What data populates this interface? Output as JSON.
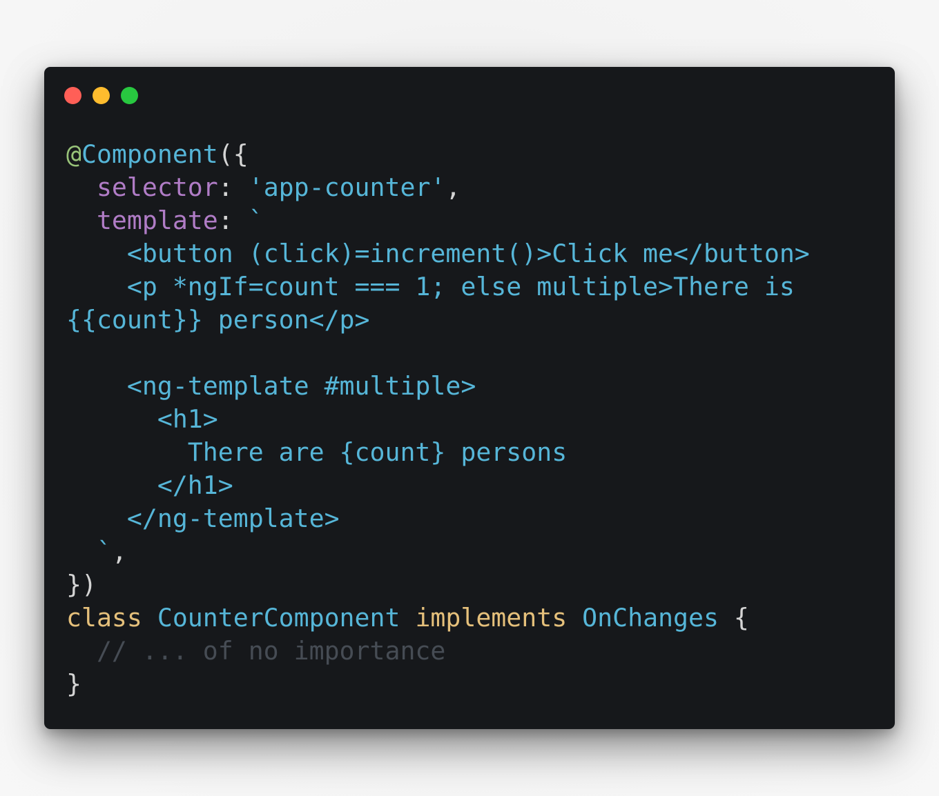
{
  "window": {
    "buttons": [
      {
        "name": "close",
        "color": "#ff5f57"
      },
      {
        "name": "minimize",
        "color": "#febc2e"
      },
      {
        "name": "zoom",
        "color": "#28c840"
      }
    ]
  },
  "colors": {
    "background": "#16181b",
    "default": "#56b6d8",
    "decorator": "#98c379",
    "property": "#b07cc6",
    "punctuation": "#d4d4d4",
    "keyword": "#e5c07b",
    "comment": "#464c54"
  },
  "code": {
    "lines": [
      [
        {
          "t": "@",
          "c": "decorator"
        },
        {
          "t": "Component",
          "c": "default"
        },
        {
          "t": "({",
          "c": "punctuation"
        }
      ],
      [
        {
          "t": "  ",
          "c": "default"
        },
        {
          "t": "selector",
          "c": "property"
        },
        {
          "t": ": ",
          "c": "punctuation"
        },
        {
          "t": "'app-counter'",
          "c": "default"
        },
        {
          "t": ",",
          "c": "punctuation"
        }
      ],
      [
        {
          "t": "  ",
          "c": "default"
        },
        {
          "t": "template",
          "c": "property"
        },
        {
          "t": ": ",
          "c": "punctuation"
        },
        {
          "t": "`",
          "c": "default"
        }
      ],
      [
        {
          "t": "    <button (click)=increment()>Click me</button>",
          "c": "default"
        }
      ],
      [
        {
          "t": "    <p *ngIf=count === 1; else multiple>There is",
          "c": "default"
        }
      ],
      [
        {
          "t": "{{count}} person</p>",
          "c": "default"
        }
      ],
      [
        {
          "t": "",
          "c": "default"
        }
      ],
      [
        {
          "t": "    <ng-template #multiple>",
          "c": "default"
        }
      ],
      [
        {
          "t": "      <h1>",
          "c": "default"
        }
      ],
      [
        {
          "t": "        There are {count} persons",
          "c": "default"
        }
      ],
      [
        {
          "t": "      </h1>",
          "c": "default"
        }
      ],
      [
        {
          "t": "    </ng-template>",
          "c": "default"
        }
      ],
      [
        {
          "t": "  `",
          "c": "default"
        },
        {
          "t": ",",
          "c": "punctuation"
        }
      ],
      [
        {
          "t": "})",
          "c": "punctuation"
        }
      ],
      [
        {
          "t": "class ",
          "c": "keyword"
        },
        {
          "t": "CounterComponent ",
          "c": "default"
        },
        {
          "t": "implements ",
          "c": "keyword"
        },
        {
          "t": "OnChanges ",
          "c": "default"
        },
        {
          "t": "{",
          "c": "punctuation"
        }
      ],
      [
        {
          "t": "  // ... of no importance",
          "c": "comment"
        }
      ],
      [
        {
          "t": "}",
          "c": "punctuation"
        }
      ]
    ]
  }
}
